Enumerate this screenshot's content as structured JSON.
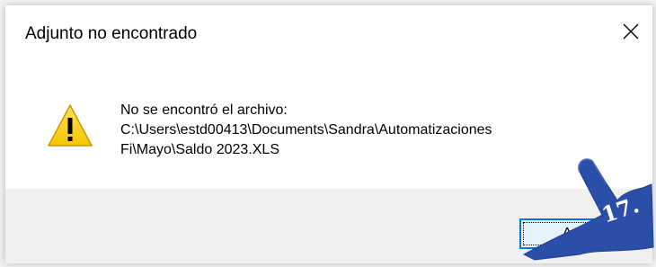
{
  "dialog": {
    "title": "Adjunto no encontrado",
    "close_symbol": "✕",
    "icon": "warning-icon",
    "message_lines": [
      "No se encontró el archivo:",
      "C:\\Users\\estd00413\\Documents\\Sandra\\Automatizaciones",
      "Fi\\Mayo\\Saldo 2023.XLS"
    ],
    "ok_button_label": "Acep"
  },
  "annotation": {
    "step_label": "17.",
    "pointer_color": "#2b4fa8"
  }
}
